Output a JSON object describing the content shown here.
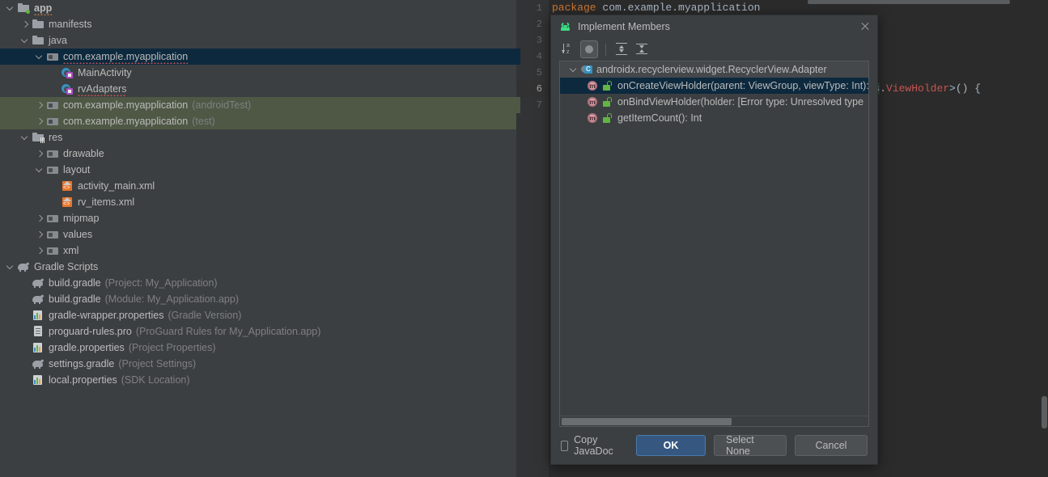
{
  "project_tree": {
    "name": "project-tree",
    "rows": [
      {
        "depth": 0,
        "arrow": "down",
        "icon": "folder-module-icon",
        "label": "app",
        "bold": true,
        "squiggle": "orange"
      },
      {
        "depth": 1,
        "arrow": "right",
        "icon": "folder-icon",
        "label": "manifests"
      },
      {
        "depth": 1,
        "arrow": "down",
        "icon": "folder-icon",
        "label": "java"
      },
      {
        "depth": 2,
        "arrow": "down",
        "icon": "package-folder-icon",
        "label": "com.example.myapplication",
        "state": "selected",
        "squiggle": "red"
      },
      {
        "depth": 3,
        "arrow": "none",
        "icon": "kotlin-class-icon",
        "label": "MainActivity"
      },
      {
        "depth": 3,
        "arrow": "none",
        "icon": "kotlin-class-icon",
        "label": "rvAdapters",
        "squiggle": "red"
      },
      {
        "depth": 2,
        "arrow": "right",
        "icon": "package-folder-icon",
        "label": "com.example.myapplication",
        "sub": "(androidTest)",
        "state": "testsrc"
      },
      {
        "depth": 2,
        "arrow": "right",
        "icon": "package-folder-icon",
        "label": "com.example.myapplication",
        "sub": "(test)",
        "state": "testsrc"
      },
      {
        "depth": 1,
        "arrow": "down",
        "icon": "res-folder-icon",
        "label": "res"
      },
      {
        "depth": 2,
        "arrow": "right",
        "icon": "package-folder-icon",
        "label": "drawable"
      },
      {
        "depth": 2,
        "arrow": "down",
        "icon": "package-folder-icon",
        "label": "layout"
      },
      {
        "depth": 3,
        "arrow": "none",
        "icon": "xml-layout-icon",
        "label": "activity_main.xml"
      },
      {
        "depth": 3,
        "arrow": "none",
        "icon": "xml-layout-icon",
        "label": "rv_items.xml"
      },
      {
        "depth": 2,
        "arrow": "right",
        "icon": "package-folder-icon",
        "label": "mipmap"
      },
      {
        "depth": 2,
        "arrow": "right",
        "icon": "package-folder-icon",
        "label": "values"
      },
      {
        "depth": 2,
        "arrow": "right",
        "icon": "package-folder-icon",
        "label": "xml"
      },
      {
        "depth": 0,
        "arrow": "down",
        "icon": "gradle-icon",
        "label": "Gradle Scripts"
      },
      {
        "depth": 1,
        "arrow": "none",
        "icon": "gradle-icon",
        "label": "build.gradle",
        "sub": "(Project: My_Application)"
      },
      {
        "depth": 1,
        "arrow": "none",
        "icon": "gradle-icon",
        "label": "build.gradle",
        "sub": "(Module: My_Application.app)"
      },
      {
        "depth": 1,
        "arrow": "none",
        "icon": "properties-icon",
        "label": "gradle-wrapper.properties",
        "sub": "(Gradle Version)"
      },
      {
        "depth": 1,
        "arrow": "none",
        "icon": "text-file-icon",
        "label": "proguard-rules.pro",
        "sub": "(ProGuard Rules for My_Application.app)"
      },
      {
        "depth": 1,
        "arrow": "none",
        "icon": "properties-icon",
        "label": "gradle.properties",
        "sub": "(Project Properties)"
      },
      {
        "depth": 1,
        "arrow": "none",
        "icon": "gradle-icon",
        "label": "settings.gradle",
        "sub": "(Project Settings)"
      },
      {
        "depth": 1,
        "arrow": "none",
        "icon": "properties-icon",
        "label": "local.properties",
        "sub": "(SDK Location)"
      }
    ]
  },
  "editor": {
    "line_numbers": [
      "1",
      "2",
      "3",
      "4",
      "5",
      "6",
      "7"
    ],
    "current_line": "6",
    "lines": [
      {
        "n": 1,
        "segments": [
          {
            "t": "package ",
            "c": "kw"
          },
          {
            "t": "com.example.myapplication",
            "c": "pl"
          }
        ]
      },
      {
        "n": 2,
        "segments": []
      },
      {
        "n": 3,
        "segments": []
      },
      {
        "n": 4,
        "segments": []
      },
      {
        "n": 5,
        "segments": []
      },
      {
        "n": 6,
        "segments": [
          {
            "t": "ters",
            "c": "hl"
          },
          {
            "t": ".",
            "c": "pl"
          },
          {
            "t": "ViewHolder",
            "c": "red"
          },
          {
            "t": ">() {",
            "c": "pl"
          }
        ]
      },
      {
        "n": 7,
        "segments": []
      }
    ]
  },
  "dialog": {
    "title": "Implement Members",
    "title_icon": "android-icon",
    "close_icon": "close-icon",
    "toolbar": [
      {
        "name": "sort-alphabetically-button",
        "icon": "sort-az-icon",
        "pressed": false
      },
      {
        "name": "show-overloads-button",
        "icon": "filled-circle-icon",
        "pressed": true
      },
      {
        "name": "expand-all-button",
        "icon": "expand-all-icon",
        "pressed": false
      },
      {
        "name": "collapse-all-button",
        "icon": "collapse-all-icon",
        "pressed": false
      }
    ],
    "list": [
      {
        "type": "class",
        "icon": "class-icon",
        "arrow": "down",
        "label": "androidx.recyclerview.widget.RecyclerView.Adapter",
        "state": "class-header"
      },
      {
        "type": "member",
        "icon": "method-icon",
        "visibility_icon": "unlocked-padlock-icon",
        "label": "onCreateViewHolder(parent: ViewGroup, viewType: Int):",
        "state": "selected"
      },
      {
        "type": "member",
        "icon": "method-icon",
        "visibility_icon": "unlocked-padlock-icon",
        "label": "onBindViewHolder(holder: [Error type: Unresolved type",
        "state": "normal"
      },
      {
        "type": "member",
        "icon": "method-icon",
        "visibility_icon": "unlocked-padlock-icon",
        "label": "getItemCount(): Int",
        "state": "normal"
      }
    ],
    "footer": {
      "copy_javadoc_label": "Copy JavaDoc",
      "copy_javadoc_checked": false,
      "ok_label": "OK",
      "select_none_label": "Select None",
      "cancel_label": "Cancel"
    }
  },
  "colors": {
    "window_bg": "#3c3f41",
    "editor_bg": "#2b2b2b",
    "selection_blue": "#0d293e",
    "test_source_green": "#4e5845",
    "accent_button": "#365880",
    "android_green": "#3ddc84",
    "keyword_orange": "#cc7832",
    "error_red": "#c75450"
  }
}
